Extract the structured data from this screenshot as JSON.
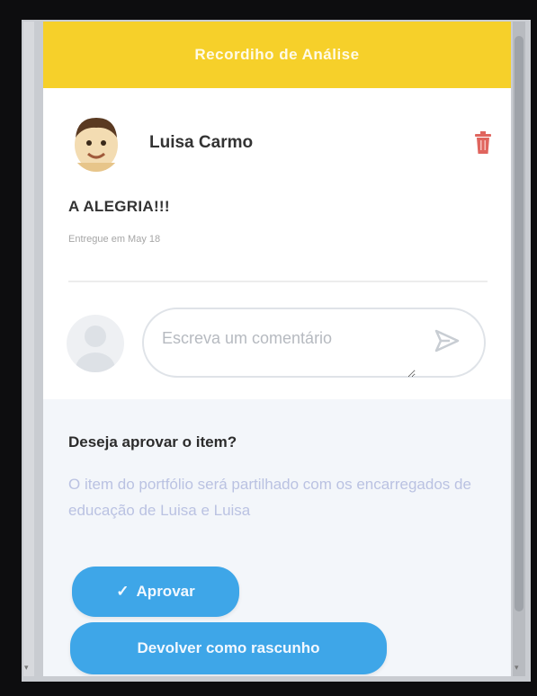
{
  "header": {
    "title": "Recordiho de Análise"
  },
  "author": {
    "name": "Luisa Carmo",
    "avatar_icon": "child-avatar-icon",
    "delete_icon": "trash-icon"
  },
  "item": {
    "title": "A ALEGRIA!!!",
    "subtitle": "Entregue em May 18"
  },
  "comment": {
    "placeholder": "Escreva um comentário",
    "send_icon": "send-icon"
  },
  "approval": {
    "question": "Deseja aprovar o item?",
    "description": "O item do portfólio será partilhado com os encarregados de educação de Luisa e Luisa",
    "approve_label": "Aprovar",
    "approve_icon": "check-icon",
    "return_label": "Devolver como rascunho"
  },
  "colors": {
    "header": "#f6d02a",
    "accent": "#3ea6e8",
    "delete": "#e0655e"
  }
}
